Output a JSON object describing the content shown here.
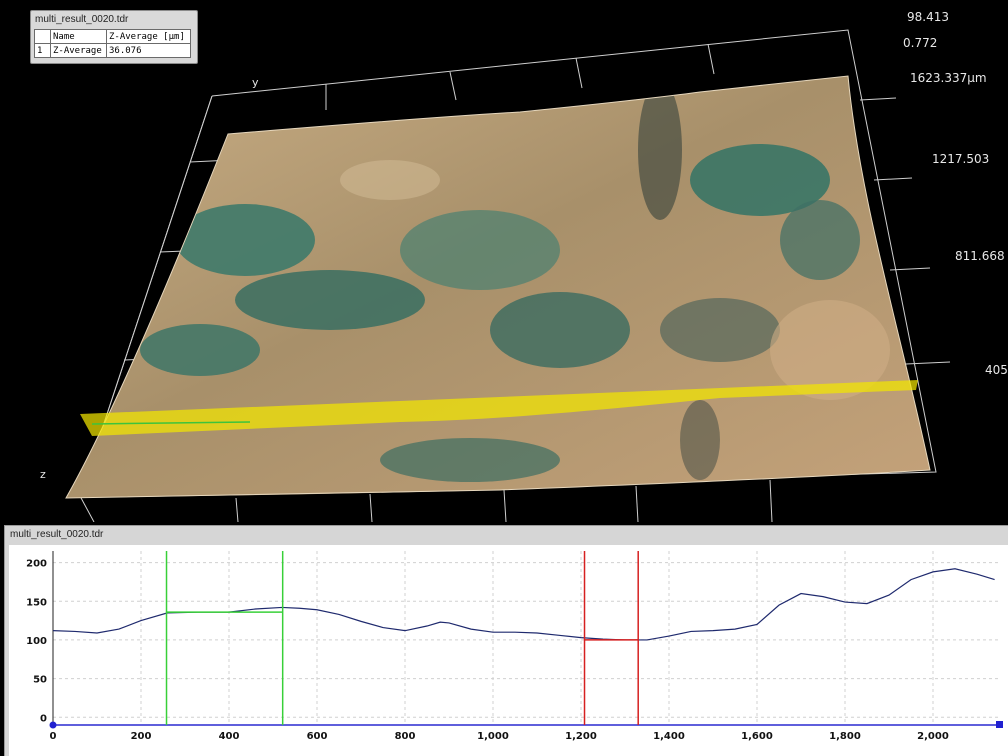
{
  "result_window": {
    "title": "multi_result_0020.tdr",
    "columns": [
      "",
      "Name",
      "Z-Average [µm]"
    ],
    "rows": [
      {
        "index": "1",
        "name": "Z-Average",
        "value": "36.076"
      }
    ]
  },
  "viewer3d": {
    "scale_labels": [
      "98.413",
      "0.772",
      "1623.337µm",
      "1217.503",
      "811.668",
      "405"
    ],
    "axis_labels": {
      "y": "y",
      "z": "z"
    },
    "colors": {
      "highlight_band": "#f2e600",
      "grid_lines": "#c8c8c8",
      "surface_sand": "#b39a73",
      "surface_green": "#3f7a6a"
    }
  },
  "profile_window": {
    "title": "multi_result_0020.tdr",
    "chart_data": {
      "type": "line",
      "xlim": [
        0,
        2150
      ],
      "ylim": [
        -10,
        215
      ],
      "x_ticks": [
        0,
        200,
        400,
        600,
        800,
        1000,
        1200,
        1400,
        1600,
        1800,
        2000
      ],
      "x_tick_labels": [
        "0",
        "200",
        "400",
        "600",
        "800",
        "1,000",
        "1,200",
        "1,400",
        "1,600",
        "1,800",
        "2,000"
      ],
      "y_ticks": [
        0,
        50,
        100,
        150,
        200
      ],
      "y_tick_labels": [
        "0",
        "50",
        "100",
        "150",
        "200"
      ],
      "grid": true,
      "series": [
        {
          "color": "#1f2a6e",
          "x": [
            0,
            50,
            100,
            150,
            200,
            260,
            330,
            400,
            460,
            520,
            560,
            600,
            650,
            700,
            750,
            800,
            850,
            880,
            900,
            950,
            1000,
            1050,
            1100,
            1150,
            1200,
            1250,
            1300,
            1350,
            1400,
            1450,
            1500,
            1550,
            1600,
            1650,
            1700,
            1750,
            1800,
            1850,
            1900,
            1950,
            2000,
            2050,
            2100,
            2140
          ],
          "y": [
            112,
            111,
            109,
            114,
            125,
            135,
            136,
            136,
            140,
            142,
            141,
            139,
            133,
            124,
            116,
            112,
            118,
            123,
            122,
            114,
            110,
            110,
            109,
            106,
            103,
            101,
            100,
            100,
            105,
            111,
            112,
            114,
            120,
            145,
            160,
            156,
            149,
            147,
            158,
            178,
            188,
            192,
            185,
            178
          ]
        }
      ],
      "cursors": [
        {
          "color": "#38d038",
          "x1": 258,
          "x2": 522,
          "level": 136
        },
        {
          "color": "#d62020",
          "x1": 1208,
          "x2": 1330,
          "level": 100
        }
      ]
    }
  }
}
